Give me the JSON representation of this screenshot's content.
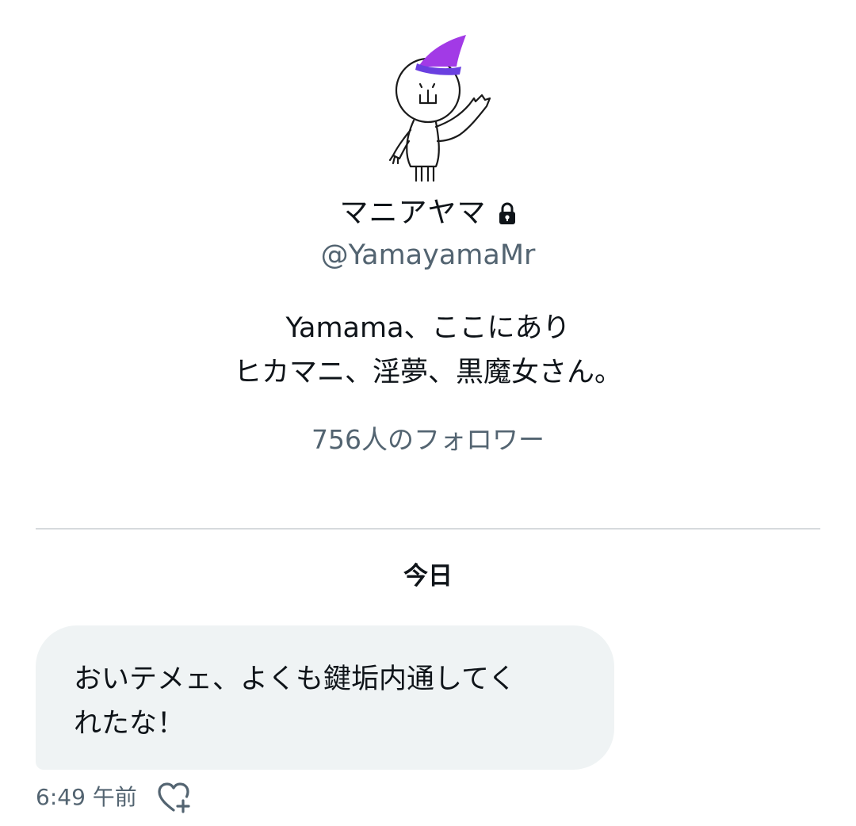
{
  "profile": {
    "display_name": "マニアヤマ",
    "handle": "@YamayamaMr",
    "bio_lines": [
      "Yamama、ここにあり",
      "ヒカマニ、淫夢、黒魔女さん。"
    ],
    "followers": "756人のフォロワー",
    "avatar_icon": "wizard-doodle-avatar",
    "lock_icon": "lock-icon",
    "hat_color": "#a23ae6",
    "hat_band_color": "#6a3fe0"
  },
  "conversation": {
    "date_label": "今日",
    "messages": [
      {
        "text": "おいテメェ、よくも鍵垢内通してく\nれたな！",
        "time": "6:49 午前",
        "reaction_icon": "heart-plus-icon"
      }
    ]
  },
  "colors": {
    "primary_text": "#0f1419",
    "secondary_text": "#536471",
    "bubble_bg": "#eff3f4",
    "divider": "#d6dadd"
  }
}
